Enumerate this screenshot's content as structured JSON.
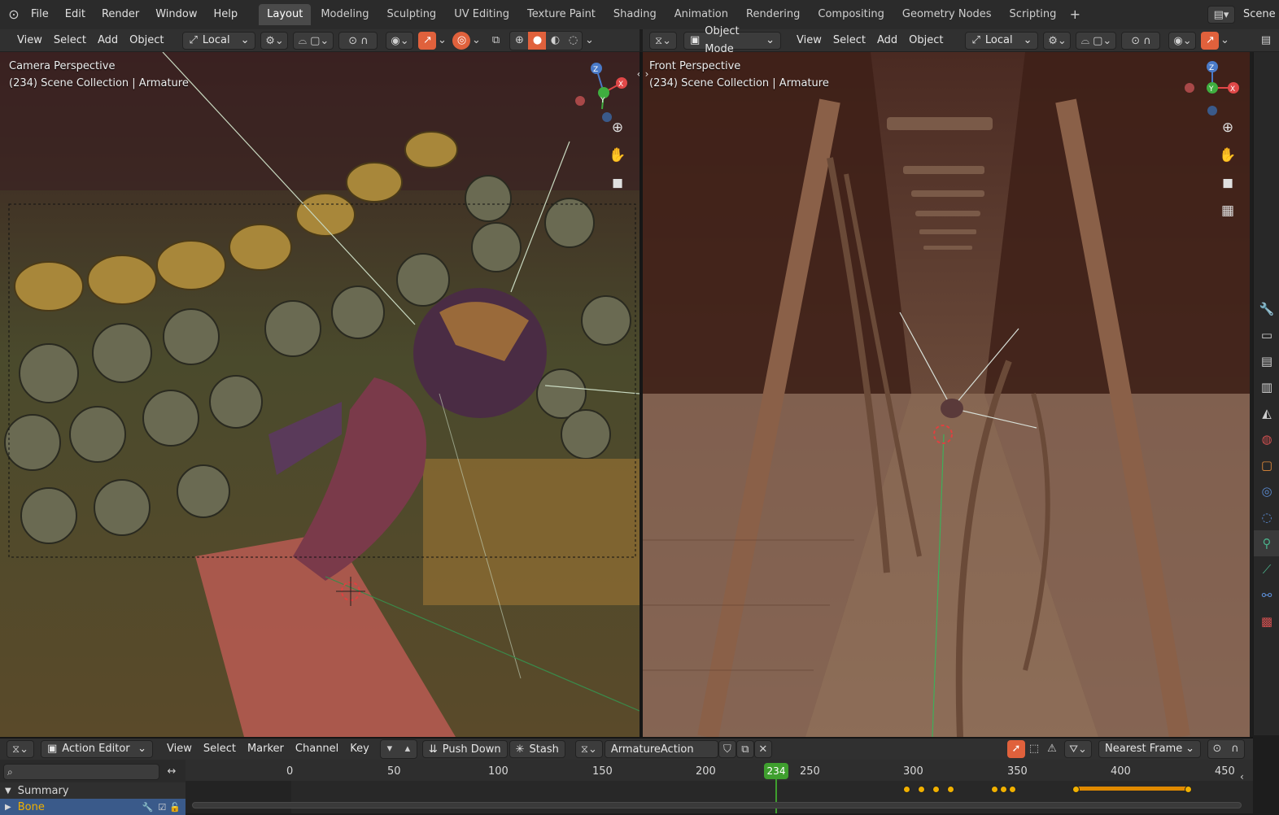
{
  "menubar": {
    "items": [
      "File",
      "Edit",
      "Render",
      "Window",
      "Help"
    ],
    "workspaces": [
      "Layout",
      "Modeling",
      "Sculpting",
      "UV Editing",
      "Texture Paint",
      "Shading",
      "Animation",
      "Rendering",
      "Compositing",
      "Geometry Nodes",
      "Scripting"
    ],
    "active_workspace": "Layout",
    "add_tab": "+",
    "scene": "Scene"
  },
  "left_viewport": {
    "menu": [
      "View",
      "Select",
      "Add",
      "Object"
    ],
    "transform_orientation": "Local",
    "overlay_title": "Camera Perspective",
    "overlay_subtitle": "(234) Scene Collection | Armature"
  },
  "right_viewport": {
    "mode": "Object Mode",
    "menu": [
      "View",
      "Select",
      "Add",
      "Object"
    ],
    "transform_orientation": "Local",
    "overlay_title": "Front Perspective",
    "overlay_subtitle": "(234) Scene Collection | Armature"
  },
  "gizmo_labels": {
    "z": "Z",
    "y": "Y",
    "x": "X"
  },
  "action_editor": {
    "editor_type": "Action Editor",
    "menu": [
      "View",
      "Select",
      "Marker",
      "Channel",
      "Key"
    ],
    "push_down": "Push Down",
    "stash": "Stash",
    "action_name": "ArmatureAction",
    "snapping": "Nearest Frame",
    "search_placeholder": "",
    "timeline_ticks": [
      "0",
      "50",
      "100",
      "150",
      "200",
      "250",
      "300",
      "350",
      "400",
      "450"
    ],
    "current_frame": "234",
    "channels": [
      {
        "name": "Summary"
      },
      {
        "name": "Bone"
      }
    ]
  },
  "colors": {
    "accent": "#e0613c",
    "current_frame": "#3f9f2e",
    "keyframe": "#f0b000"
  }
}
